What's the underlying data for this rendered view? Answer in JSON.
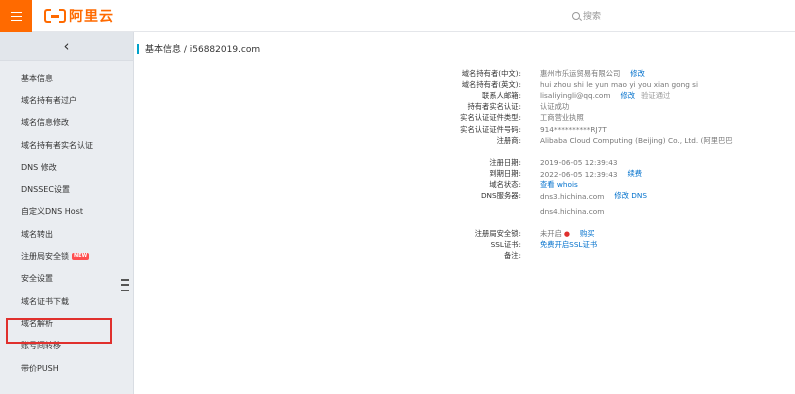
{
  "header": {
    "logo_text": "阿里云",
    "search_placeholder": "搜索"
  },
  "sidebar": {
    "items": [
      {
        "label": "基本信息"
      },
      {
        "label": "域名持有者过户"
      },
      {
        "label": "域名信息修改"
      },
      {
        "label": "域名持有者实名认证"
      },
      {
        "label": "DNS 修改"
      },
      {
        "label": "DNSSEC设置"
      },
      {
        "label": "自定义DNS Host"
      },
      {
        "label": "域名转出"
      },
      {
        "label": "注册局安全锁",
        "badge": "NEW"
      },
      {
        "label": "安全设置"
      },
      {
        "label": "域名证书下载"
      },
      {
        "label": "域名解析"
      },
      {
        "label": "账号间转移"
      },
      {
        "label": "带价PUSH"
      }
    ]
  },
  "breadcrumb": "基本信息 / i56882019.com",
  "info": {
    "rows": [
      {
        "key": "域名持有者(中文):",
        "value": "惠州市乐运贸易有限公司",
        "link": "修改"
      },
      {
        "key": "域名持有者(英文):",
        "value": "hui zhou shi le yun mao yi you xian gong si"
      },
      {
        "key": "联系人邮箱:",
        "value": "lisaliyingli@qq.com",
        "link": "修改",
        "extra": "验证通过"
      },
      {
        "key": "持有者实名认证:",
        "value": "认证成功"
      },
      {
        "key": "实名认证证件类型:",
        "value": "工商营业执照"
      },
      {
        "key": "实名认证证件号码:",
        "value": "914**********RJ7T"
      },
      {
        "key": "注册商:",
        "value": "Alibaba Cloud Computing (Beijing) Co., Ltd. (阿里巴巴"
      }
    ],
    "rows2": [
      {
        "key": "注册日期:",
        "value": "2019-06-05 12:39:43"
      },
      {
        "key": "到期日期:",
        "value": "2022-06-05 12:39:43",
        "link": "续费"
      },
      {
        "key": "域名状态:",
        "value": "查看 whois",
        "blue": true
      },
      {
        "key": "DNS服务器:",
        "value": "dns3.hichina.com",
        "link": "修改 DNS"
      },
      {
        "key": "",
        "value": "dns4.hichina.com"
      }
    ],
    "rows3": [
      {
        "key": "注册局安全锁:",
        "value": "未开启",
        "link": "购买"
      },
      {
        "key": "SSL证书:",
        "value": "免费开启SSL证书",
        "blue": true
      },
      {
        "key": "备注:",
        "value": ""
      }
    ]
  }
}
